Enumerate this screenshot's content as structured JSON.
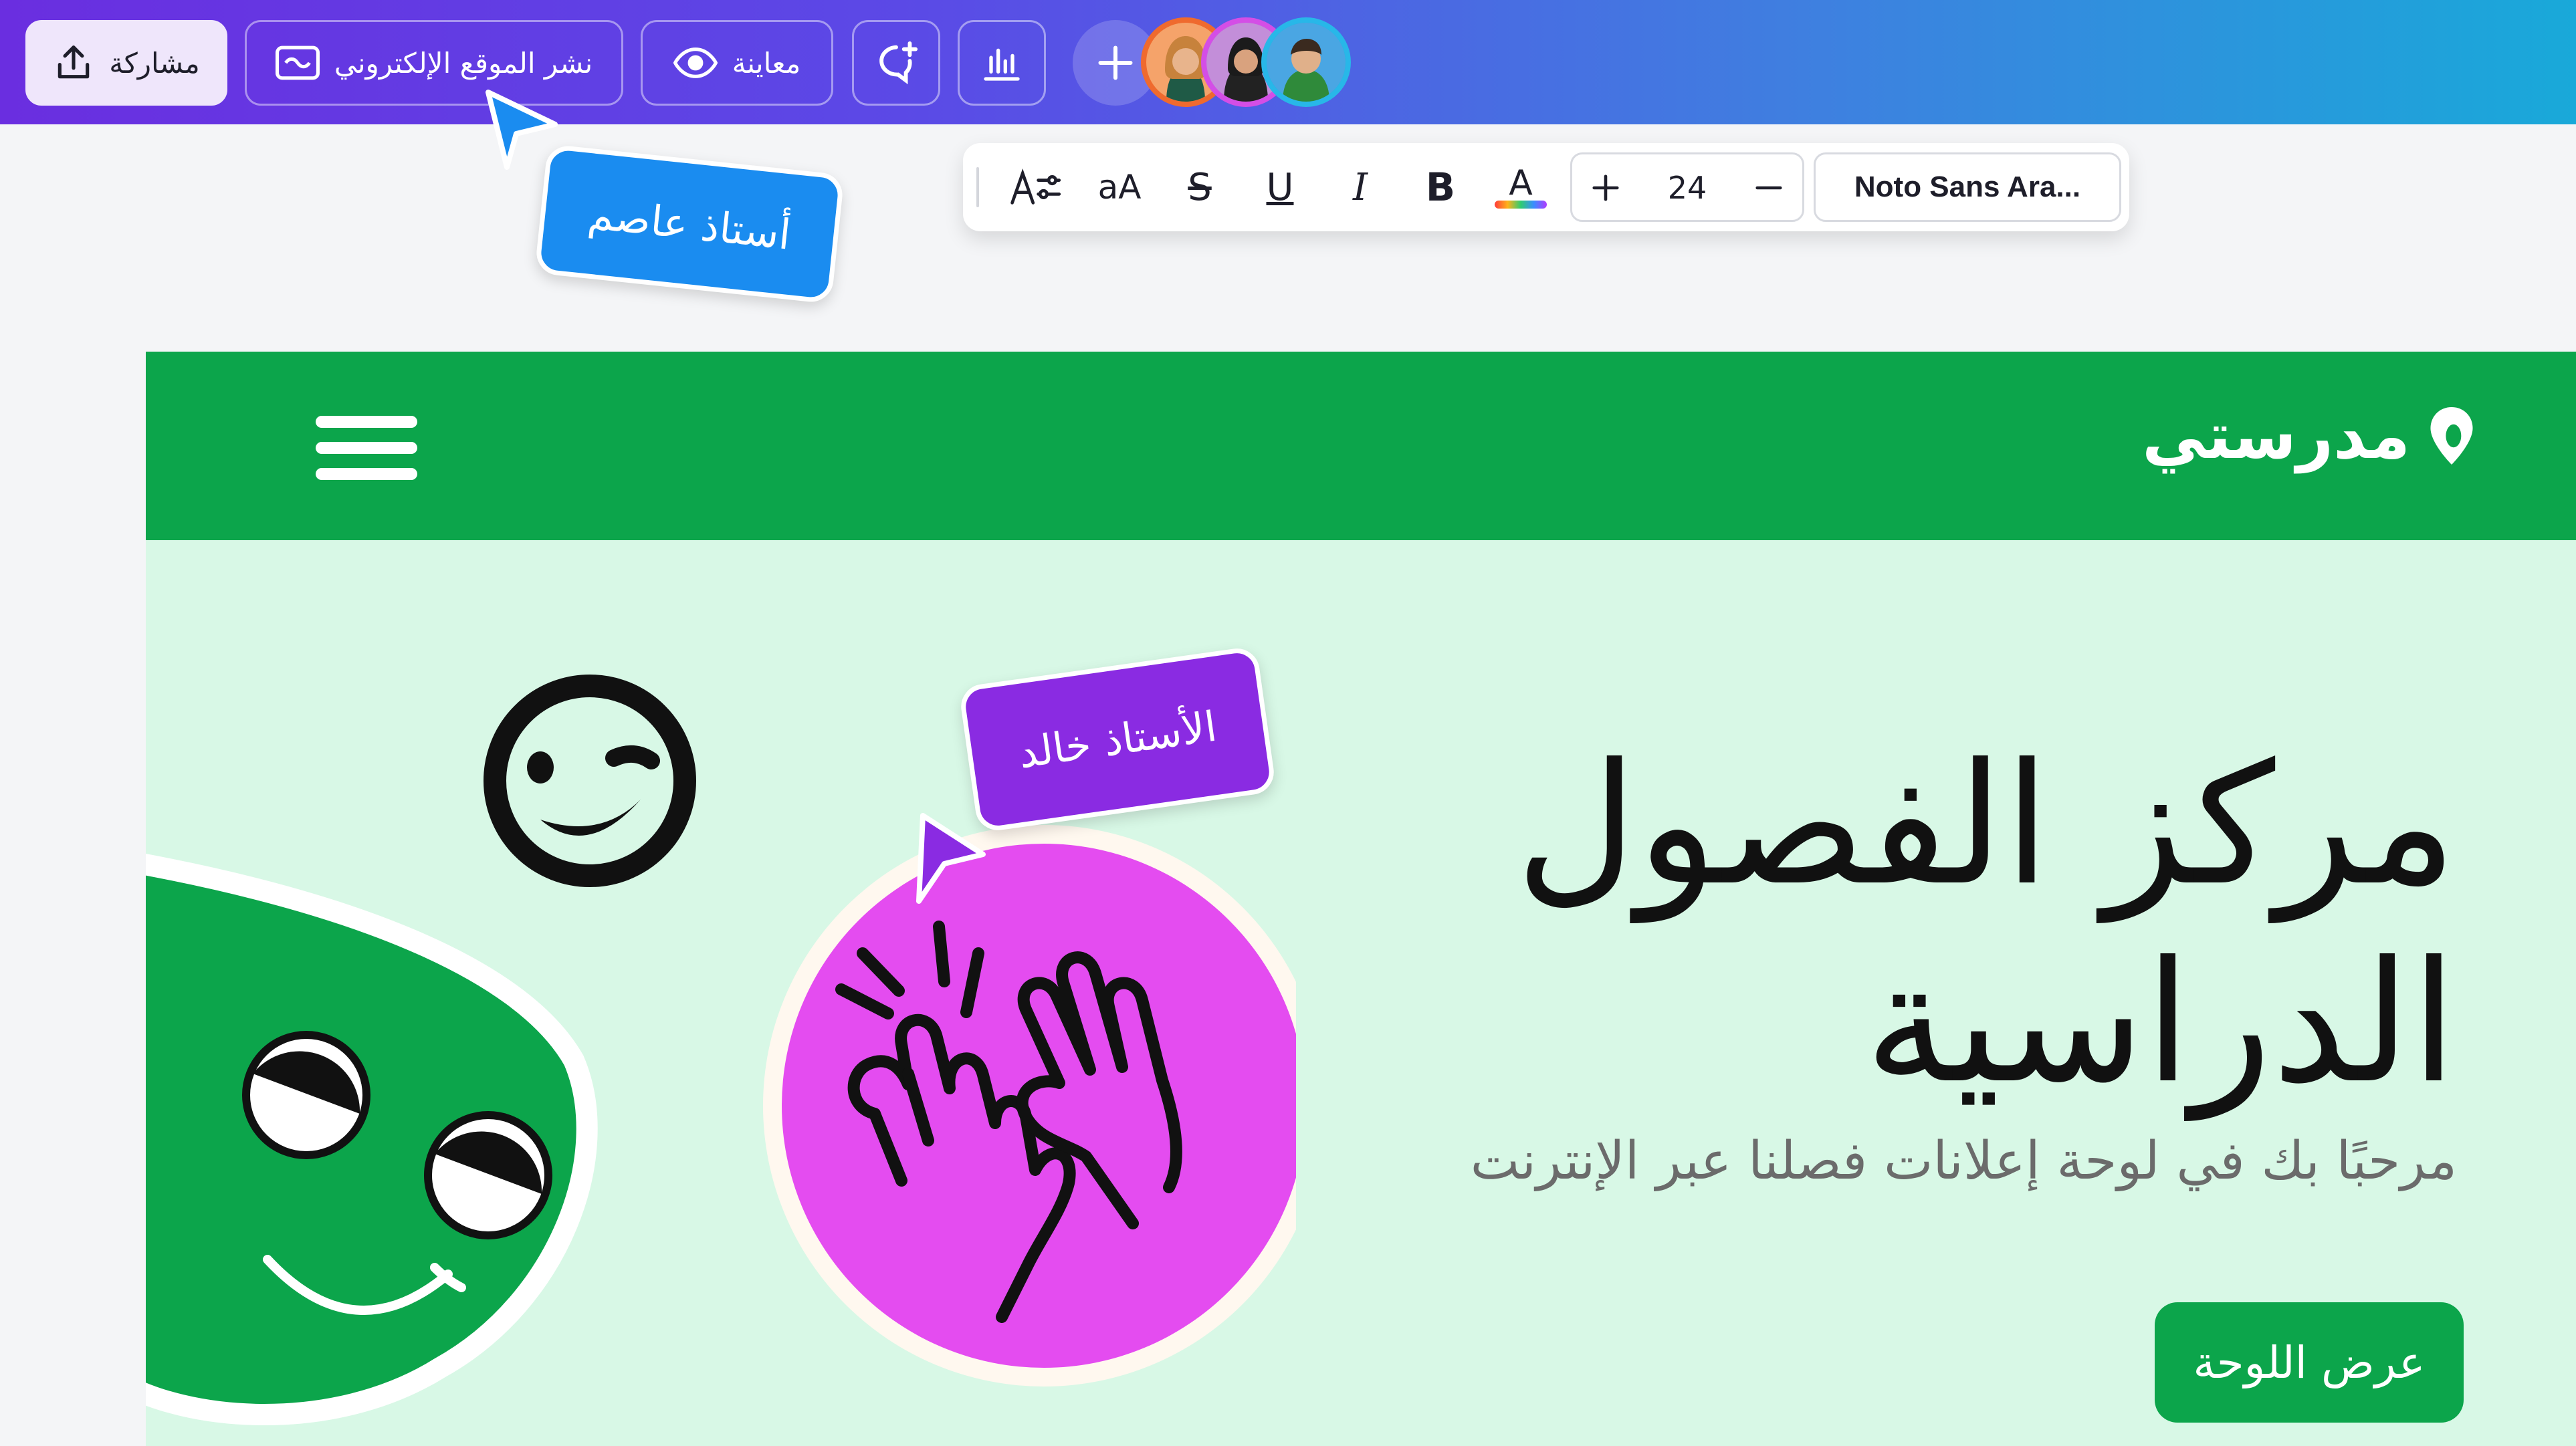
{
  "topbar": {
    "share_label": "مشاركة",
    "publish_label": "نشر الموقع الإلكتروني",
    "preview_label": "معاينة",
    "comment_icon": "comment-add-icon",
    "insights_icon": "bar-chart-icon",
    "add_icon": "plus-icon"
  },
  "format_toolbar": {
    "font_size": "24",
    "font_name": "Noto Sans Ara...",
    "bold_label": "B",
    "italic_label": "I",
    "underline_label": "U",
    "strike_label": "S",
    "case_label": "aA",
    "color_label": "A"
  },
  "collaborators": {
    "cursor_1_name": "أستاذ عاصم",
    "cursor_2_name": "الأستاذ خالد"
  },
  "site": {
    "brand": "مدرستي",
    "hero_title_line1": "مركز الفصول",
    "hero_title_line2": "الدراسية",
    "hero_subtitle": "مرحبًا بك في لوحة إعلانات فصلنا عبر الإنترنت",
    "cta_label": "عرض اللوحة"
  },
  "colors": {
    "brand_green": "#0ca54b",
    "hero_bg": "#d8f8e6",
    "sticker_pink": "#e44cf0",
    "cursor_blue": "#1a8cf0",
    "cursor_purple": "#8a2be2"
  }
}
